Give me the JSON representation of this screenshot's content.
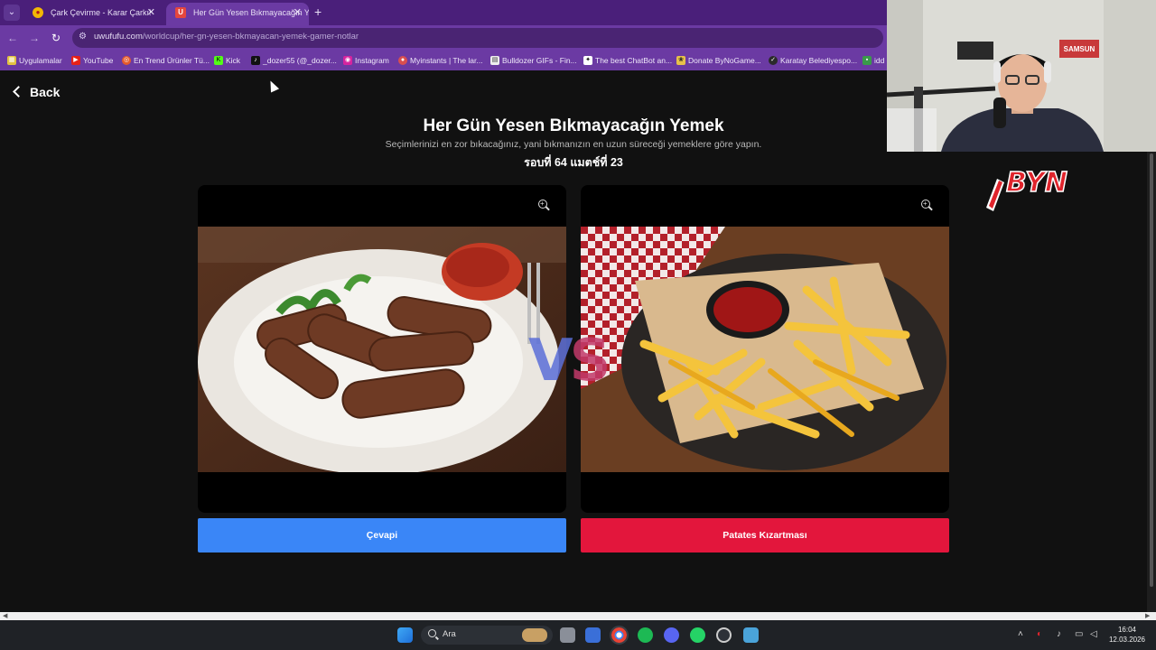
{
  "browser": {
    "tabs": [
      {
        "label": "Çark Çevirme - Karar Çarkı!",
        "active": false
      },
      {
        "label": "Her Gün Yesen Bıkmayacağın Ye",
        "active": true
      }
    ],
    "url_domain": "uwufufu.com",
    "url_path": "/worldcup/her-gn-yesen-bkmayacan-yemek-gamer-notlar",
    "bookmarks": [
      "Uygulamalar",
      "YouTube",
      "En Trend Ürünler Tü...",
      "Kick",
      "_dozer55 (@_dozer...",
      "Instagram",
      "Myinstants | The lar...",
      "Bulldozer GIFs - Fin...",
      "The best ChatBot an...",
      "Donate ByNoGame...",
      "Karatay Belediyespo...",
      "idd"
    ]
  },
  "page": {
    "back_label": "Back",
    "title": "Her Gün Yesen Bıkmayacağın Yemek",
    "subtitle": "Seçimlerinizi en zor bıkacağınız, yani bıkmanızın en uzun süreceği yemeklere göre yapın.",
    "round_text": "รอบที่ 64 แมตช์ที่ 23",
    "vs_label": "VS",
    "left_choice": "Çevapi",
    "right_choice": "Patates Kızartması"
  },
  "overlay": {
    "logo_text": "BYN",
    "webcam_label_1": "SAMSUN"
  },
  "taskbar": {
    "search_placeholder": "Ara",
    "time": "16:04",
    "date": "12.03.2026"
  },
  "colors": {
    "left_button": "#3a86f7",
    "right_button": "#e3163c",
    "browser_theme": "#6b3aa3"
  }
}
